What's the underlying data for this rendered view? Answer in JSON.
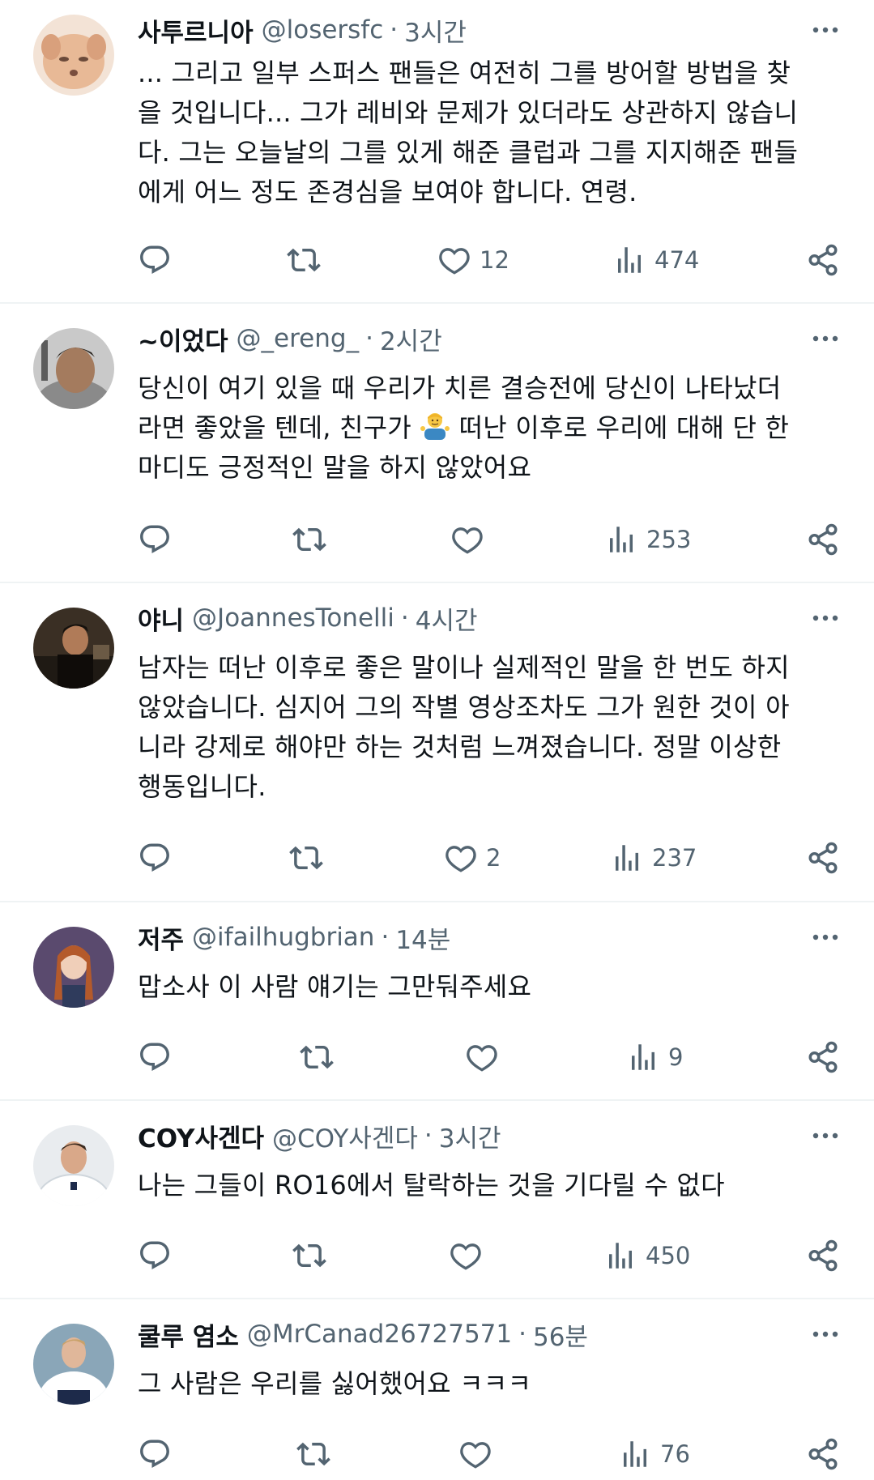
{
  "tweets": [
    {
      "name": "사투르니아",
      "handle": "@losersfc",
      "dot": "·",
      "time": "3시간",
      "lines": [
        "... 그리고 일부 스퍼스 팬들은 여전히 그를 방어할 방법을 찾",
        "을 것입니다... 그가 레비와 문제가 있더라도 상관하지 않습니",
        "다. 그는 오늘날의 그를 있게 해준 클럽과 그를 지지해준 팬들",
        "에게 어느 정도 존경심을 보여야 합니다. 연령."
      ],
      "likes": "12",
      "views": "474"
    },
    {
      "name": "~이었다",
      "handle": "@_ereng_",
      "dot": "·",
      "time": "2시간",
      "lines": [
        "당신이 여기 있을 때 우리가 치른 결승전에 당신이 나타났더",
        "라면 좋았을 텐데, 친구가",
        "떠난 이후로 우리에 대해 단 한",
        "마디도 긍정적인 말을 하지 않았어요"
      ],
      "likes": "",
      "views": "253"
    },
    {
      "name": "야니",
      "handle": "@JoannesTonelli",
      "dot": "·",
      "time": "4시간",
      "lines": [
        "남자는 떠난 이후로 좋은 말이나 실제적인 말을 한 번도 하지",
        "않았습니다. 심지어 그의 작별 영상조차도 그가 원한 것이 아",
        "니라 강제로 해야만 하는 것처럼 느껴졌습니다. 정말 이상한",
        "행동입니다."
      ],
      "likes": "2",
      "views": "237"
    },
    {
      "name": "저주",
      "handle": "@ifailhugbrian",
      "dot": "·",
      "time": "14분",
      "lines": [
        "맙소사 이 사람 얘기는 그만둬주세요"
      ],
      "likes": "",
      "views": "9"
    },
    {
      "name": "COY사겐다",
      "handle": "@COY사겐다",
      "dot": "·",
      "time": "3시간",
      "lines": [
        "나는 그들이 RO16에서 탈락하는 것을 기다릴 수 없다"
      ],
      "likes": "",
      "views": "450"
    },
    {
      "name": "쿨루 염소",
      "handle": "@MrCanad26727571",
      "dot": "·",
      "time": "56분",
      "lines": [
        "그 사람은 우리를 싫어했어요 ㅋㅋㅋ"
      ],
      "likes": "",
      "views": "76"
    }
  ],
  "icons": {
    "reply": "reply-icon",
    "retweet": "retweet-icon",
    "like": "heart-icon",
    "views": "views-icon",
    "share": "share-icon",
    "more": "more-icon",
    "emoji": "person-shrugging-emoji"
  },
  "colors": {
    "text": "#0f1419",
    "secondary": "#536471",
    "divider": "#eff3f4"
  }
}
